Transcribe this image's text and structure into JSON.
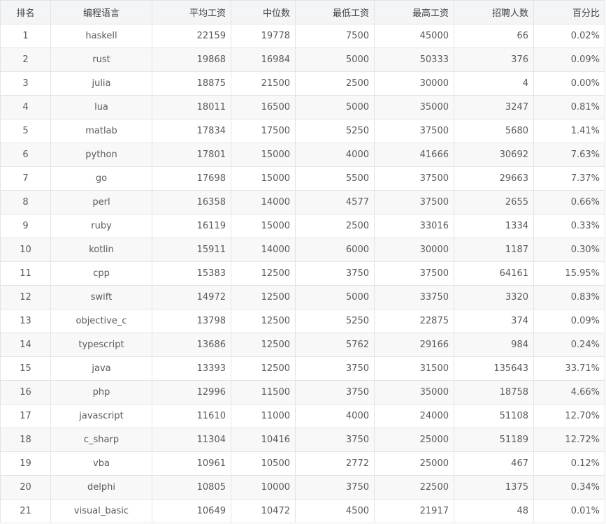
{
  "table": {
    "headers": [
      "排名",
      "编程语言",
      "平均工资",
      "中位数",
      "最低工资",
      "最高工资",
      "招聘人数",
      "百分比"
    ],
    "rows": [
      [
        "1",
        "haskell",
        "22159",
        "19778",
        "7500",
        "45000",
        "66",
        "0.02%"
      ],
      [
        "2",
        "rust",
        "19868",
        "16984",
        "5000",
        "50333",
        "376",
        "0.09%"
      ],
      [
        "3",
        "julia",
        "18875",
        "21500",
        "2500",
        "30000",
        "4",
        "0.00%"
      ],
      [
        "4",
        "lua",
        "18011",
        "16500",
        "5000",
        "35000",
        "3247",
        "0.81%"
      ],
      [
        "5",
        "matlab",
        "17834",
        "17500",
        "5250",
        "37500",
        "5680",
        "1.41%"
      ],
      [
        "6",
        "python",
        "17801",
        "15000",
        "4000",
        "41666",
        "30692",
        "7.63%"
      ],
      [
        "7",
        "go",
        "17698",
        "15000",
        "5500",
        "37500",
        "29663",
        "7.37%"
      ],
      [
        "8",
        "perl",
        "16358",
        "14000",
        "4577",
        "37500",
        "2655",
        "0.66%"
      ],
      [
        "9",
        "ruby",
        "16119",
        "15000",
        "2500",
        "33016",
        "1334",
        "0.33%"
      ],
      [
        "10",
        "kotlin",
        "15911",
        "14000",
        "6000",
        "30000",
        "1187",
        "0.30%"
      ],
      [
        "11",
        "cpp",
        "15383",
        "12500",
        "3750",
        "37500",
        "64161",
        "15.95%"
      ],
      [
        "12",
        "swift",
        "14972",
        "12500",
        "5000",
        "33750",
        "3320",
        "0.83%"
      ],
      [
        "13",
        "objective_c",
        "13798",
        "12500",
        "5250",
        "22875",
        "374",
        "0.09%"
      ],
      [
        "14",
        "typescript",
        "13686",
        "12500",
        "5762",
        "29166",
        "984",
        "0.24%"
      ],
      [
        "15",
        "java",
        "13393",
        "12500",
        "3750",
        "31500",
        "135643",
        "33.71%"
      ],
      [
        "16",
        "php",
        "12996",
        "11500",
        "3750",
        "35000",
        "18758",
        "4.66%"
      ],
      [
        "17",
        "javascript",
        "11610",
        "11000",
        "4000",
        "24000",
        "51108",
        "12.70%"
      ],
      [
        "18",
        "c_sharp",
        "11304",
        "10416",
        "3750",
        "25000",
        "51189",
        "12.72%"
      ],
      [
        "19",
        "vba",
        "10961",
        "10500",
        "2772",
        "25000",
        "467",
        "0.12%"
      ],
      [
        "20",
        "delphi",
        "10805",
        "10000",
        "3750",
        "22500",
        "1375",
        "0.34%"
      ],
      [
        "21",
        "visual_basic",
        "10649",
        "10472",
        "4500",
        "21917",
        "48",
        "0.01%"
      ]
    ]
  }
}
